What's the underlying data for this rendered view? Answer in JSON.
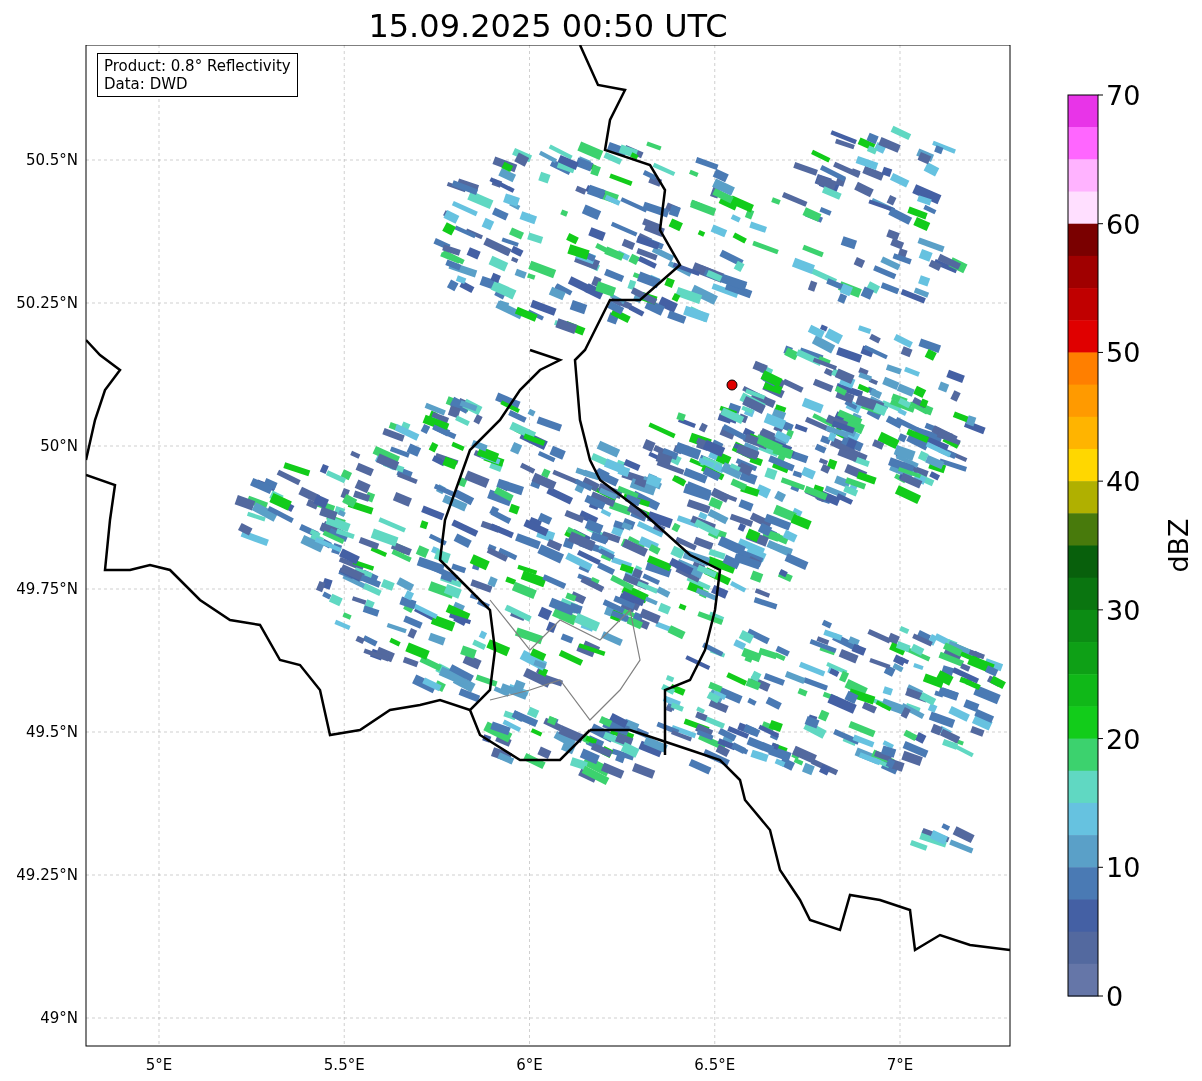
{
  "title": "15.09.2025 00:50 UTC",
  "info_box": {
    "lines": [
      "Product: 0.8° Reflectivity",
      "Data: DWD"
    ]
  },
  "map": {
    "lat_ticks": [
      "50.5°N",
      "50.25°N",
      "50°N",
      "49.75°N",
      "49.5°N",
      "49.25°N",
      "49°N"
    ],
    "lon_ticks": [
      "5°E",
      "5.5°E",
      "6°E",
      "6.5°E",
      "7°E"
    ]
  },
  "colorbar": {
    "label": "dBZ",
    "ticks": [
      "70",
      "60",
      "50",
      "40",
      "30",
      "20",
      "10",
      "0"
    ],
    "bands": [
      {
        "color": "#e834e8"
      },
      {
        "color": "#ff66ff"
      },
      {
        "color": "#ffb3ff"
      },
      {
        "color": "#ffdfff"
      },
      {
        "color": "#7a0000"
      },
      {
        "color": "#a00000"
      },
      {
        "color": "#c00000"
      },
      {
        "color": "#e00000"
      },
      {
        "color": "#ff7f00"
      },
      {
        "color": "#ff9a00"
      },
      {
        "color": "#ffb400"
      },
      {
        "color": "#ffd700"
      },
      {
        "color": "#b0b000"
      },
      {
        "color": "#487a0c"
      },
      {
        "color": "#08600c"
      },
      {
        "color": "#0a7510"
      },
      {
        "color": "#0c8c14"
      },
      {
        "color": "#0ea016"
      },
      {
        "color": "#10b818"
      },
      {
        "color": "#12cc1a"
      },
      {
        "color": "#3cd26e"
      },
      {
        "color": "#60d8c2"
      },
      {
        "color": "#66c2e0"
      },
      {
        "color": "#5aa0c8"
      },
      {
        "color": "#4a7ab4"
      },
      {
        "color": "#4460a4"
      },
      {
        "color": "#53699f"
      },
      {
        "color": "#6576a8"
      }
    ]
  }
}
